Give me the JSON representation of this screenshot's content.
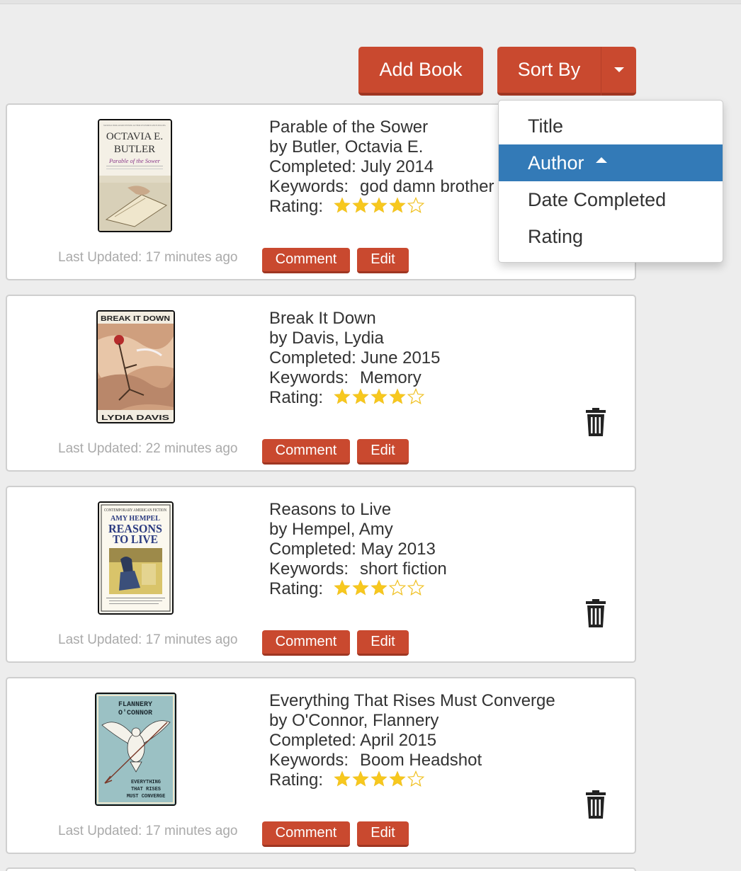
{
  "toolbar": {
    "add_book_label": "Add Book",
    "sort_by_label": "Sort By"
  },
  "sort_menu": {
    "items": [
      {
        "label": "Title",
        "active": false
      },
      {
        "label": "Author",
        "active": true
      },
      {
        "label": "Date Completed",
        "active": false
      },
      {
        "label": "Rating",
        "active": false
      }
    ]
  },
  "books": [
    {
      "title": "Parable of the Sower",
      "author_line": "by Butler, Octavia E.",
      "completed_line": "Completed: July 2014",
      "keywords_label": "Keywords:",
      "keywords": "god damn brother",
      "rating_label": "Rating:",
      "rating": 4,
      "rating_max": 5,
      "last_updated": "Last Updated: 17 minutes ago",
      "comment_label": "Comment",
      "edit_label": "Edit",
      "cover": {
        "top_text": "NATIONAL BOOK AWARD WINNING AUTHOR OF KINDRED AND FLEDGLING",
        "line1": "OCTAVIA E.",
        "line2": "BUTLER",
        "subtitle": "Parable of the Sower"
      }
    },
    {
      "title": "Break It Down",
      "author_line": "by Davis, Lydia",
      "completed_line": "Completed: June 2015",
      "keywords_label": "Keywords:",
      "keywords": "Memory",
      "rating_label": "Rating:",
      "rating": 4,
      "rating_max": 5,
      "last_updated": "Last Updated: 22 minutes ago",
      "comment_label": "Comment",
      "edit_label": "Edit",
      "cover": {
        "top": "BREAK IT DOWN",
        "bottom": "LYDIA DAVIS"
      }
    },
    {
      "title": "Reasons to Live",
      "author_line": "by Hempel, Amy",
      "completed_line": "Completed: May 2013",
      "keywords_label": "Keywords:",
      "keywords": "short fiction",
      "rating_label": "Rating:",
      "rating": 3,
      "rating_max": 5,
      "last_updated": "Last Updated: 17 minutes ago",
      "comment_label": "Comment",
      "edit_label": "Edit",
      "cover": {
        "series": "CONTEMPORARY AMERICAN FICTION",
        "author": "AMY HEMPEL",
        "title1": "REASONS",
        "title2": "TO LIVE"
      }
    },
    {
      "title": "Everything That Rises Must Converge",
      "author_line": "by O'Connor, Flannery",
      "completed_line": "Completed: April 2015",
      "keywords_label": "Keywords:",
      "keywords": "Boom Headshot",
      "rating_label": "Rating:",
      "rating": 4,
      "rating_max": 5,
      "last_updated": "Last Updated: 17 minutes ago",
      "comment_label": "Comment",
      "edit_label": "Edit",
      "cover": {
        "author1": "FLANNERY",
        "author2": "O'CONNOR",
        "t1": "EVERYTHING",
        "t2": "THAT RISES",
        "t3": "MUST CONVERGE"
      }
    }
  ],
  "colors": {
    "accent": "#c9492f",
    "active_menu": "#337ab7",
    "star_filled": "#f7c81e",
    "star_empty_stroke": "#f0c020"
  }
}
